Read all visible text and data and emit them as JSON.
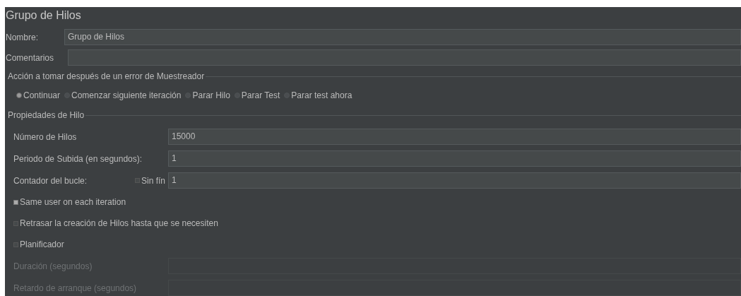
{
  "panel": {
    "title": "Grupo de Hilos"
  },
  "name_field": {
    "label": "Nombre:",
    "value": "Grupo de Hilos"
  },
  "comments_field": {
    "label": "Comentarios"
  },
  "error_action": {
    "title": "Acción a tomar después de un error de Muestreador",
    "options": [
      {
        "label": "Continuar",
        "selected": true
      },
      {
        "label": "Comenzar siguiente iteración",
        "selected": false
      },
      {
        "label": "Parar Hilo",
        "selected": false
      },
      {
        "label": "Parar Test",
        "selected": false
      },
      {
        "label": "Parar test ahora",
        "selected": false
      }
    ]
  },
  "thread_properties": {
    "title": "Propiedades de Hilo",
    "rows": [
      {
        "kind": "field",
        "label": "Número de Hilos",
        "value": "15000",
        "disabled": false
      },
      {
        "kind": "field",
        "label": "Periodo de Subida (en segundos):",
        "value": "1",
        "disabled": false
      },
      {
        "kind": "loop",
        "label": "Contador del bucle:",
        "checkbox": {
          "label": "Sin fín",
          "checked": false
        },
        "value": "1",
        "disabled": false
      },
      {
        "kind": "checkbox",
        "label": "Same user on each iteration",
        "checked": true
      },
      {
        "kind": "checkbox",
        "label": "Retrasar la creación de Hilos hasta que se necesiten",
        "checked": false
      },
      {
        "kind": "checkbox",
        "label": "Planificador",
        "checked": false
      },
      {
        "kind": "field",
        "label": "Duración (segundos)",
        "disabled": true
      },
      {
        "kind": "field",
        "label": "Retardo de arranque (segundos)",
        "disabled": true
      }
    ]
  }
}
